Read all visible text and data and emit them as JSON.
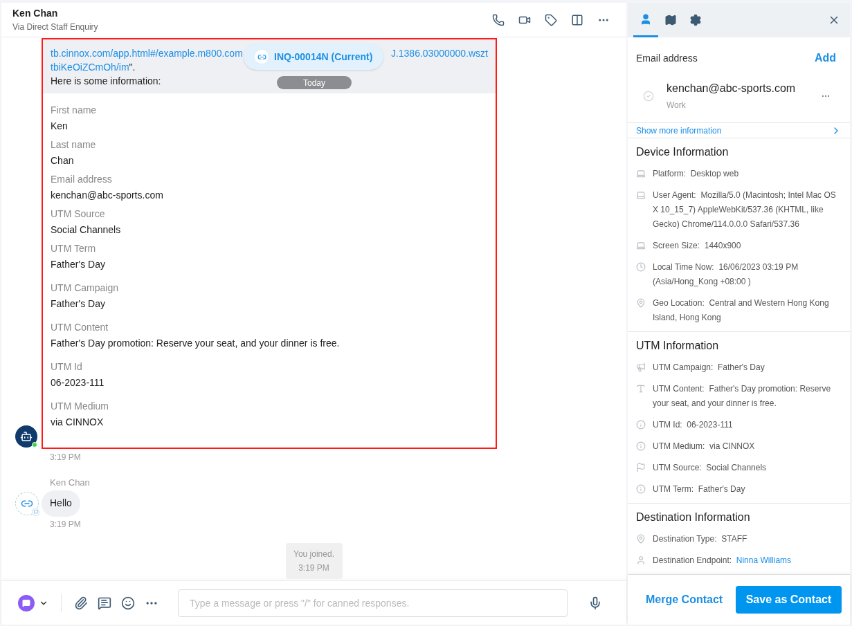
{
  "header": {
    "name": "Ken Chan",
    "subtitle": "Via Direct Staff Enquiry"
  },
  "message": {
    "link_start": "tb.cinnox.com/app.html#/example.m800.com",
    "link_end": "J.1386.03000000.wszt",
    "link_line2": "tbiKeOiZCmOh/im",
    "link_suffix": "\".",
    "intro": "Here is some information:",
    "fields": [
      {
        "label": "First name",
        "value": "Ken"
      },
      {
        "label": "Last name",
        "value": "Chan"
      },
      {
        "label": "Email address",
        "value": "kenchan@abc-sports.com"
      },
      {
        "label": "UTM Source",
        "value": "Social Channels"
      },
      {
        "label": "UTM Term",
        "value": "Father's Day"
      },
      {
        "label": "UTM Campaign",
        "value": "Father's Day"
      },
      {
        "label": "UTM Content",
        "value": "Father's Day promotion: Reserve your seat, and your dinner is free."
      },
      {
        "label": "UTM Id",
        "value": "06-2023-111"
      },
      {
        "label": "UTM Medium",
        "value": "via CINNOX"
      }
    ],
    "time": "3:19 PM",
    "bot_online": true
  },
  "inquiry_pill": "INQ-00014N (Current)",
  "date_pill": "Today",
  "reply": {
    "sender": "Ken Chan",
    "text": "Hello",
    "time": "3:19 PM"
  },
  "system_note": {
    "text": "You joined.",
    "time": "3:19 PM"
  },
  "composer": {
    "placeholder": "Type a message or press \"/\" for canned responses."
  },
  "panel": {
    "tabs": [
      {
        "selected": true
      },
      {
        "selected": false
      },
      {
        "selected": false
      }
    ],
    "email_heading": "Email address",
    "add": "Add",
    "email": "kenchan@abc-sports.com",
    "email_type": "Work",
    "email_verified": false,
    "show_more": "Show more information",
    "sections": [
      {
        "title": "Device Information",
        "rows": [
          {
            "kind": "laptop",
            "label": "Platform:",
            "value": "Desktop web"
          },
          {
            "kind": "laptop",
            "label": "User Agent:",
            "value": "Mozilla/5.0 (Macintosh; Intel Mac OS X 10_15_7) AppleWebKit/537.36 (KHTML, like Gecko) Chrome/114.0.0.0 Safari/537.36"
          },
          {
            "kind": "laptop",
            "label": "Screen Size:",
            "value": "1440x900"
          },
          {
            "kind": "clock",
            "label": "Local Time Now:",
            "value": "16/06/2023 03:19 PM (Asia/Hong_Kong +08:00 )"
          },
          {
            "kind": "pin",
            "label": "Geo Location:",
            "value": "Central and Western Hong Kong Island, Hong Kong"
          }
        ]
      },
      {
        "title": "UTM Information",
        "rows": [
          {
            "kind": "megaphone",
            "label": "UTM Campaign:",
            "value": "Father's Day"
          },
          {
            "kind": "text",
            "label": "UTM Content:",
            "value": "Father's Day promotion: Reserve your seat, and your dinner is free."
          },
          {
            "kind": "info",
            "label": "UTM Id:",
            "value": "06-2023-111"
          },
          {
            "kind": "info",
            "label": "UTM Medium:",
            "value": "via CINNOX"
          },
          {
            "kind": "flag",
            "label": "UTM Source:",
            "value": "Social Channels"
          },
          {
            "kind": "info",
            "label": "UTM Term:",
            "value": "Father's Day"
          }
        ]
      },
      {
        "title": "Destination Information",
        "rows": [
          {
            "kind": "pin",
            "label": "Destination Type:",
            "value": "STAFF",
            "link": false
          },
          {
            "kind": "user",
            "label": "Destination Endpoint:",
            "value": "Ninna Williams",
            "link": true
          }
        ]
      }
    ],
    "merge": "Merge Contact",
    "save": "Save as Contact"
  }
}
